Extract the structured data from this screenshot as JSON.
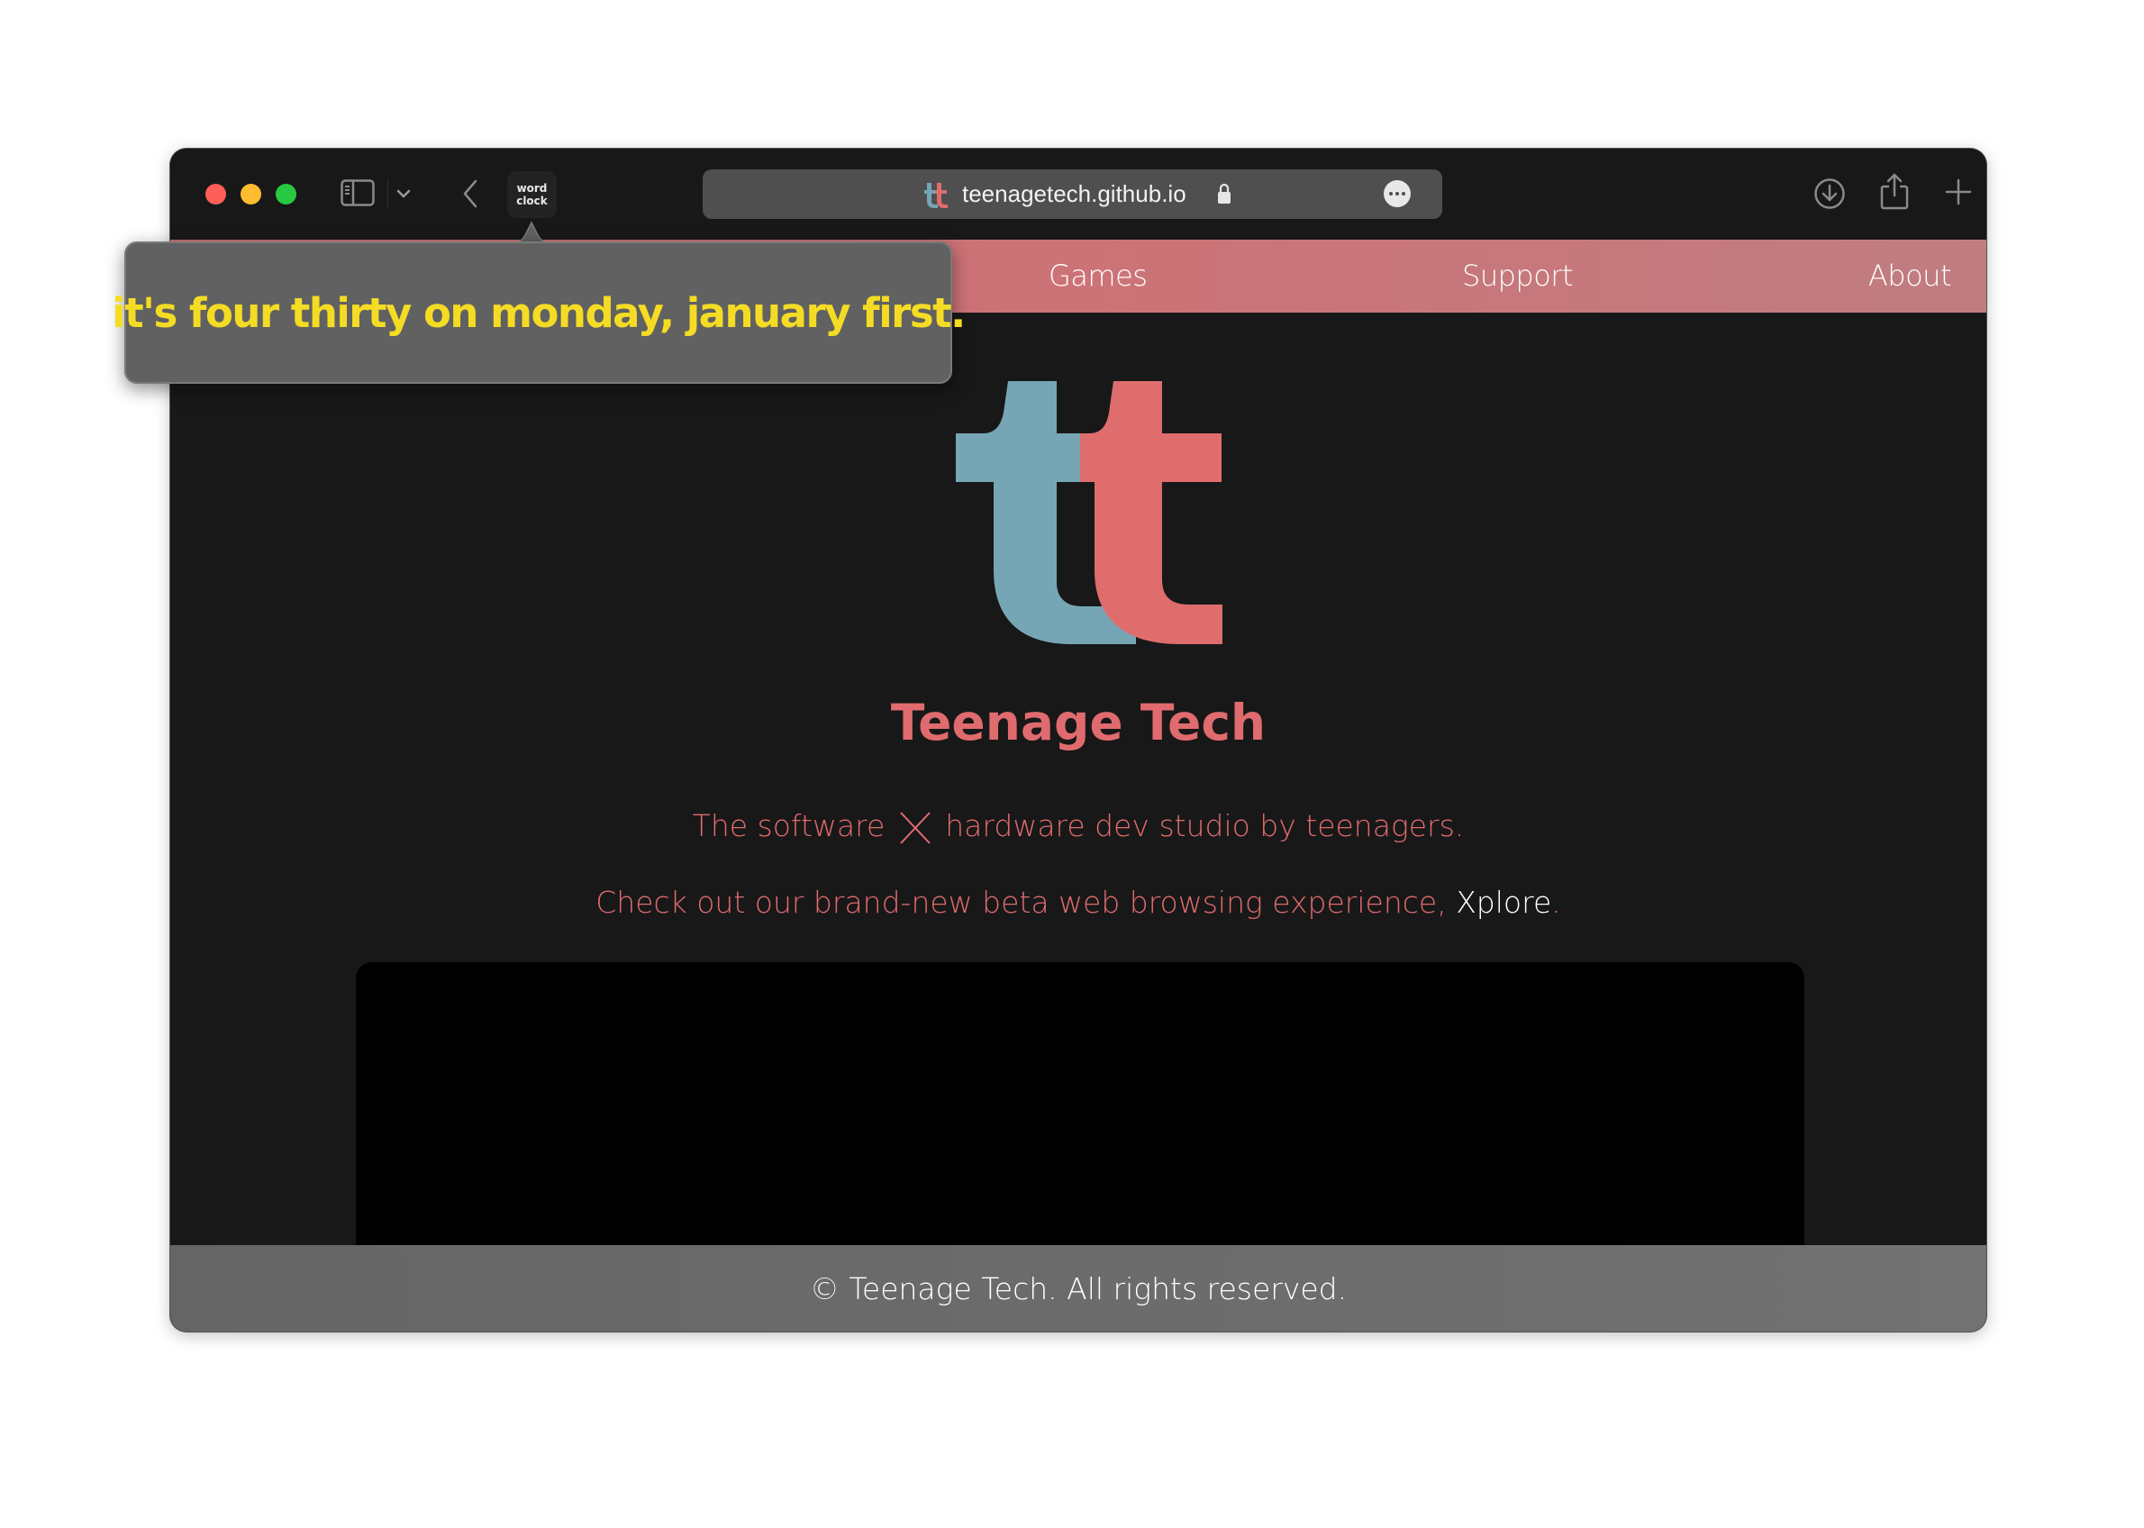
{
  "browser": {
    "extension": {
      "label_line1": "word",
      "label_line2": "clock"
    },
    "address_bar": {
      "url": "teenagetech.github.io"
    },
    "icons": {
      "sidebar": "sidebar-icon",
      "chevron": "chevron-down-icon",
      "back": "chevron-left-icon",
      "lock": "lock-icon",
      "more": "ellipsis-circle-icon",
      "download": "download-icon",
      "share": "share-icon",
      "new_tab": "plus-icon"
    }
  },
  "popover": {
    "message": "it's four thirty on monday, january first."
  },
  "site": {
    "nav": [
      {
        "label": "Games"
      },
      {
        "label": "Support"
      },
      {
        "label": "About"
      }
    ],
    "title": "Teenage Tech",
    "tagline_part1": "The software",
    "tagline_part2": "hardware dev studio by teenagers.",
    "promo_text": "Check out our brand-new beta web browsing experience,",
    "promo_link": "Xplore",
    "promo_end": ".",
    "footer": "© Teenage Tech. All rights reserved.",
    "colors": {
      "brand_red": "#e06b6e",
      "brand_blue": "#76a6b5",
      "nav_bg": "#cc7377",
      "clock_text": "#f5dc24"
    }
  }
}
